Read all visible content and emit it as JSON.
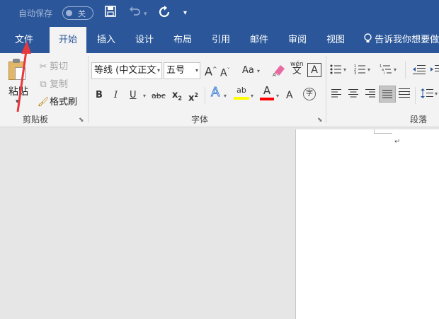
{
  "qat": {
    "autosave_label": "自动保存",
    "autosave_state": "关",
    "save_icon": "save-icon",
    "undo_icon": "undo-icon",
    "redo_icon": "redo-icon",
    "customize_icon": "customize-qat-icon"
  },
  "tabs": [
    "文件",
    "开始",
    "插入",
    "设计",
    "布局",
    "引用",
    "邮件",
    "审阅",
    "视图"
  ],
  "active_tab": "开始",
  "tell_me": "告诉我你想要做",
  "clipboard": {
    "paste": "粘贴",
    "cut": "剪切",
    "copy": "复制",
    "format_painter": "格式刷",
    "group": "剪贴板"
  },
  "font": {
    "name": "等线 (中文正文)",
    "size": "五号",
    "grow": "A",
    "shrink": "A",
    "change_case": "Aa",
    "phonetic_top": "wén",
    "phonetic_char": "文",
    "char_border": "A",
    "bold": "B",
    "italic": "I",
    "underline": "U",
    "strike": "abc",
    "subscript": "x",
    "subscript_suffix": "2",
    "superscript": "x",
    "superscript_suffix": "2",
    "text_effects": "A",
    "highlight": "ab",
    "font_color": "A",
    "enclose": "字",
    "group": "字体"
  },
  "paragraph": {
    "group": "段落"
  },
  "document": {
    "paragraph_mark": "↵"
  },
  "colors": {
    "accent": "#2b579a",
    "highlight": "#ffff00",
    "font_color": "#ff0000",
    "annotation_arrow": "#e8383d"
  }
}
